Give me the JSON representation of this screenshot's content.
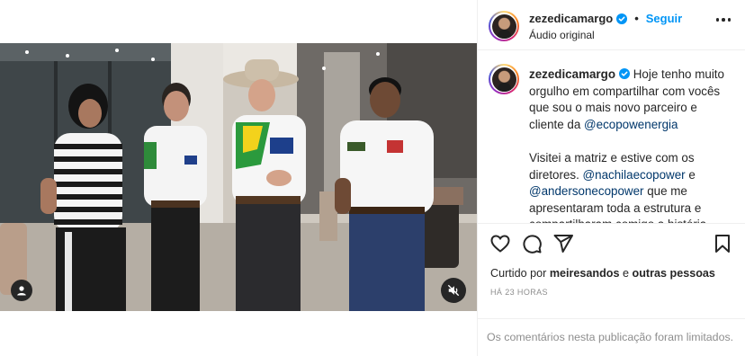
{
  "header": {
    "username": "zezedicamargo",
    "separator": "•",
    "follow_label": "Seguir",
    "audio_label": "Áudio original"
  },
  "caption": {
    "username": "zezedicamargo",
    "text_part1": " Hoje tenho muito orgulho em compartilhar com vocês que sou o mais novo parceiro e cliente da ",
    "mention1": "@ecopowenergia",
    "text_part2": "\n\nVisitei a matriz e estive com os diretores. ",
    "mention2": "@nachilaecopower",
    "text_part3": " e ",
    "mention3": "@andersonecopower",
    "text_part4": " que me apresentaram toda a estrutura e compartilharam comigo a história dessa empresa que é a maior do"
  },
  "likes": {
    "prefix": "Curtido por ",
    "user": "meiresandos",
    "middle": " e ",
    "others": "outras pessoas"
  },
  "timestamp": "HÁ 23 HORAS",
  "comments_notice": "Os comentários nesta publicação foram limitados.",
  "icons": [
    "verified-badge-icon",
    "more-options-icon",
    "heart-icon",
    "comment-icon",
    "share-icon",
    "bookmark-icon",
    "user-tag-icon",
    "speaker-muted-icon"
  ],
  "colors": {
    "accent": "#0095f6",
    "mention": "#00376b",
    "muted_text": "#8e8e8e"
  }
}
